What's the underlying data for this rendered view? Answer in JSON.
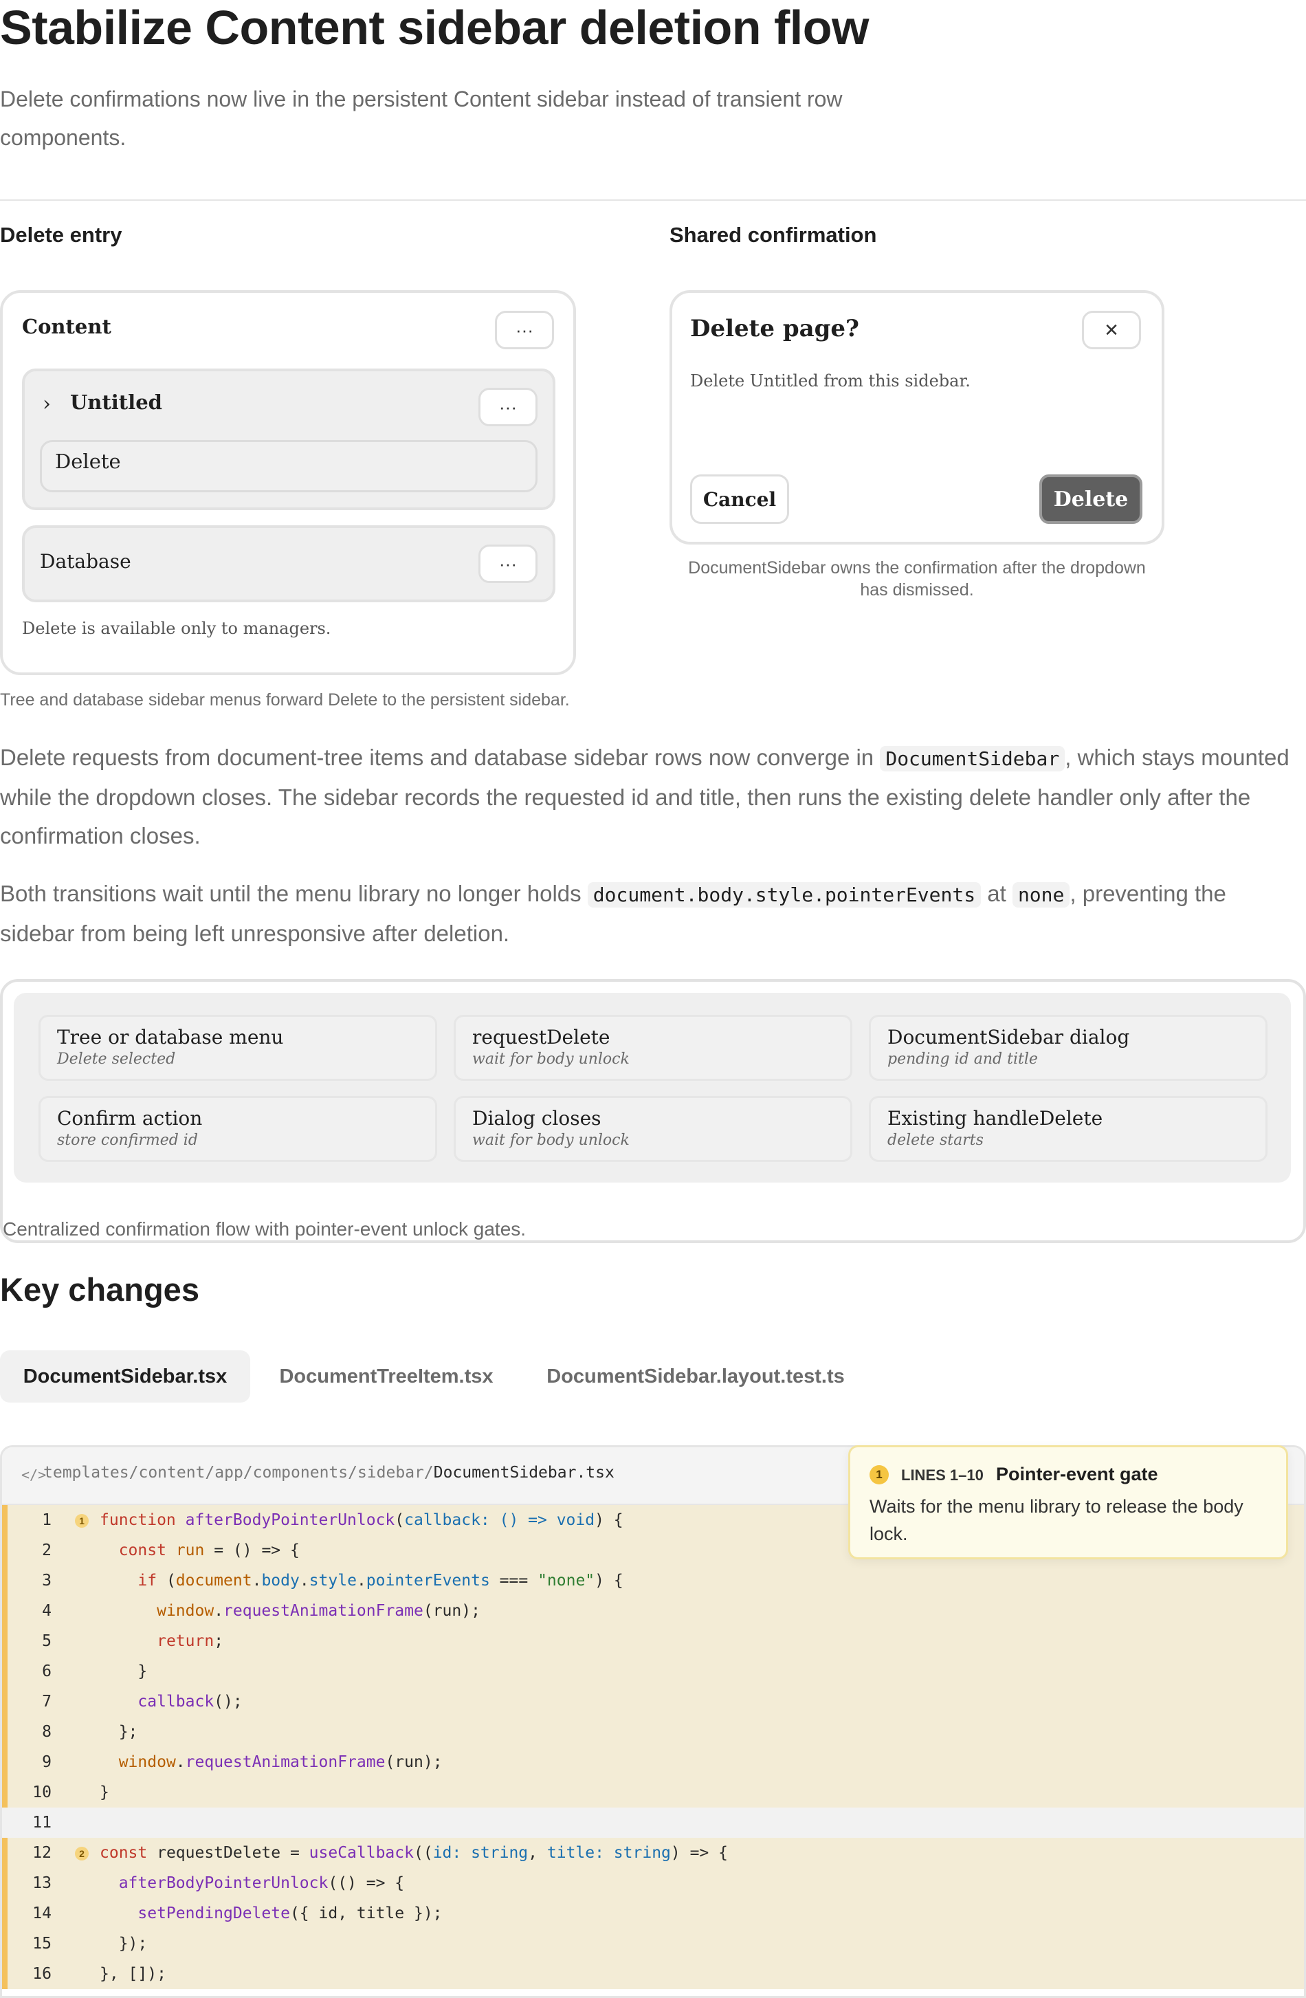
{
  "page": {
    "title": "Stabilize Content sidebar deletion flow",
    "lede": "Delete confirmations now live in the persistent Content sidebar instead of transient row components."
  },
  "delete_entry": {
    "heading": "Delete entry",
    "sidebar_title": "Content",
    "more_label": "···",
    "tree_item": {
      "chevron": "›",
      "label": "Untitled",
      "menu_item": "Delete"
    },
    "database_item": {
      "label": "Database"
    },
    "note": "Delete is available only to managers.",
    "caption": "Tree and database sidebar menus forward Delete to the persistent sidebar."
  },
  "shared_confirmation": {
    "heading": "Shared confirmation",
    "dialog_title": "Delete page?",
    "close_glyph": "✕",
    "dialog_body": "Delete Untitled from this sidebar.",
    "cancel_label": "Cancel",
    "delete_label": "Delete",
    "caption_line1": "DocumentSidebar owns the confirmation after the dropdown",
    "caption_line2": "has dismissed."
  },
  "paragraph1": {
    "before": "Delete requests from document-tree items and database sidebar rows now converge in ",
    "code": "DocumentSidebar",
    "after": ", which stays mounted while the dropdown closes. The sidebar records the requested id and title, then runs the existing delete handler only after the confirmation closes."
  },
  "paragraph2": {
    "before": "Both transitions wait until the menu library no longer holds ",
    "code1": "document.body.style.pointerEvents",
    "mid": " at ",
    "code2": "none",
    "after": ", preventing the sidebar from being left unresponsive after deletion."
  },
  "flow": {
    "cards": [
      {
        "title": "Tree or database menu",
        "sub": "Delete selected"
      },
      {
        "title": "requestDelete",
        "sub": "wait for body unlock"
      },
      {
        "title": "DocumentSidebar dialog",
        "sub": "pending id and title"
      },
      {
        "title": "Confirm action",
        "sub": "store confirmed id"
      },
      {
        "title": "Dialog closes",
        "sub": "wait for body unlock"
      },
      {
        "title": "Existing handleDelete",
        "sub": "delete starts"
      }
    ],
    "caption": "Centralized confirmation flow with pointer-event unlock gates."
  },
  "key_changes": {
    "heading": "Key changes",
    "tabs": [
      "DocumentSidebar.tsx",
      "DocumentTreeItem.tsx",
      "DocumentSidebar.layout.test.ts"
    ],
    "active_tab": "DocumentSidebar.tsx"
  },
  "code": {
    "icon": "</>",
    "path_prefix": "templates/content/app/components/sidebar/",
    "file_name": "DocumentSidebar.tsx",
    "line_numbers": [
      "1",
      "2",
      "3",
      "4",
      "5",
      "6",
      "7",
      "8",
      "9",
      "10",
      "11",
      "12",
      "13",
      "14",
      "15",
      "16"
    ],
    "badges": [
      "1",
      "2"
    ]
  },
  "annotation": {
    "number": "1",
    "lines": "LINES 1–10",
    "title": "Pointer-event gate",
    "body": "Waits for the menu library to release the body lock."
  },
  "colors": {
    "highlight": "#f3ecd6",
    "gutter": "#f4c15d",
    "note_bg": "#fdfbea",
    "keyword": "#c0392b",
    "function": "#7b2fb5",
    "param": "#1a6fb0",
    "string": "#2f7d32"
  }
}
